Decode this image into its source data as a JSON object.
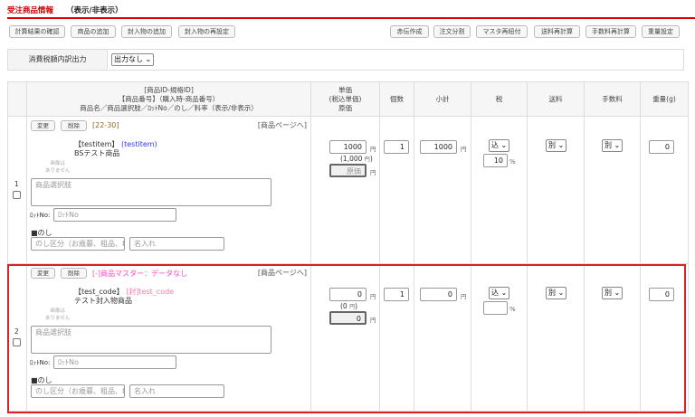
{
  "header": {
    "title": "受注商品情報",
    "toggle": "（表示/非表示）"
  },
  "toolbar_left": [
    "計算結果の確認",
    "商品の追加",
    "封入物の追加",
    "封入物の再設定"
  ],
  "toolbar_right": [
    "赤伝作成",
    "注文分割",
    "マスタ再紐付",
    "送料再計算",
    "手数料再計算",
    "重量設定"
  ],
  "tax_output": {
    "label": "消費税額内訳出力",
    "value": "出力なし"
  },
  "columns": {
    "product": [
      "[商品ID-規格ID]",
      "【商品番号】（購入時-商品番号）",
      "商品名／商品選択肢／ﾛｯﾄNo／のし／料率（表示/非表示）"
    ],
    "price": [
      "単価",
      "(税込単価)",
      "原価"
    ],
    "qty": "個数",
    "subtotal": "小計",
    "tax": "税",
    "shipping": "送料",
    "fee": "手数料",
    "weight": "重量(g)"
  },
  "labels": {
    "change": "変更",
    "delete": "削除",
    "product_page": "[商品ページへ]",
    "no_image_1": "画像は",
    "no_image_2": "ありません",
    "option_placeholder": "商品選択肢",
    "lot_label": "ﾛｯﾄNo:",
    "lot_placeholder": "ﾛｯﾄNo",
    "noshi": "■のし",
    "noshi_placeholder": "のし区分（お歳暮、粗品、Þ",
    "name_placeholder": "名入れ",
    "yen": "円",
    "percent": "%",
    "cost_placeholder": "原価"
  },
  "rows": [
    {
      "index": "1",
      "id": "[22-30]",
      "code": "【testitem】",
      "code2": "(testitem)",
      "name": "BSテスト商品",
      "price": "1000",
      "price_tax": "(1,000",
      "price_tax_end": ")",
      "cost": "",
      "qty": "1",
      "subtotal": "1000",
      "tax_type": "込",
      "tax_rate": "10",
      "shipping": "別",
      "fee": "別",
      "weight": "0"
    },
    {
      "index": "2",
      "id": "[-]商品マスター：データなし",
      "code": "【test_code】",
      "code2": "[封]test_code",
      "name": "テスト封入物商品",
      "price": "0",
      "price_tax": "(0",
      "price_tax_end": ")",
      "cost": "0",
      "qty": "1",
      "subtotal": "0",
      "tax_type": "込",
      "tax_rate": "",
      "shipping": "別",
      "fee": "別",
      "weight": "0"
    }
  ],
  "colors": {
    "accent": "#dd0000",
    "link_blue": "#3333ff",
    "pink": "#ff44cc"
  }
}
